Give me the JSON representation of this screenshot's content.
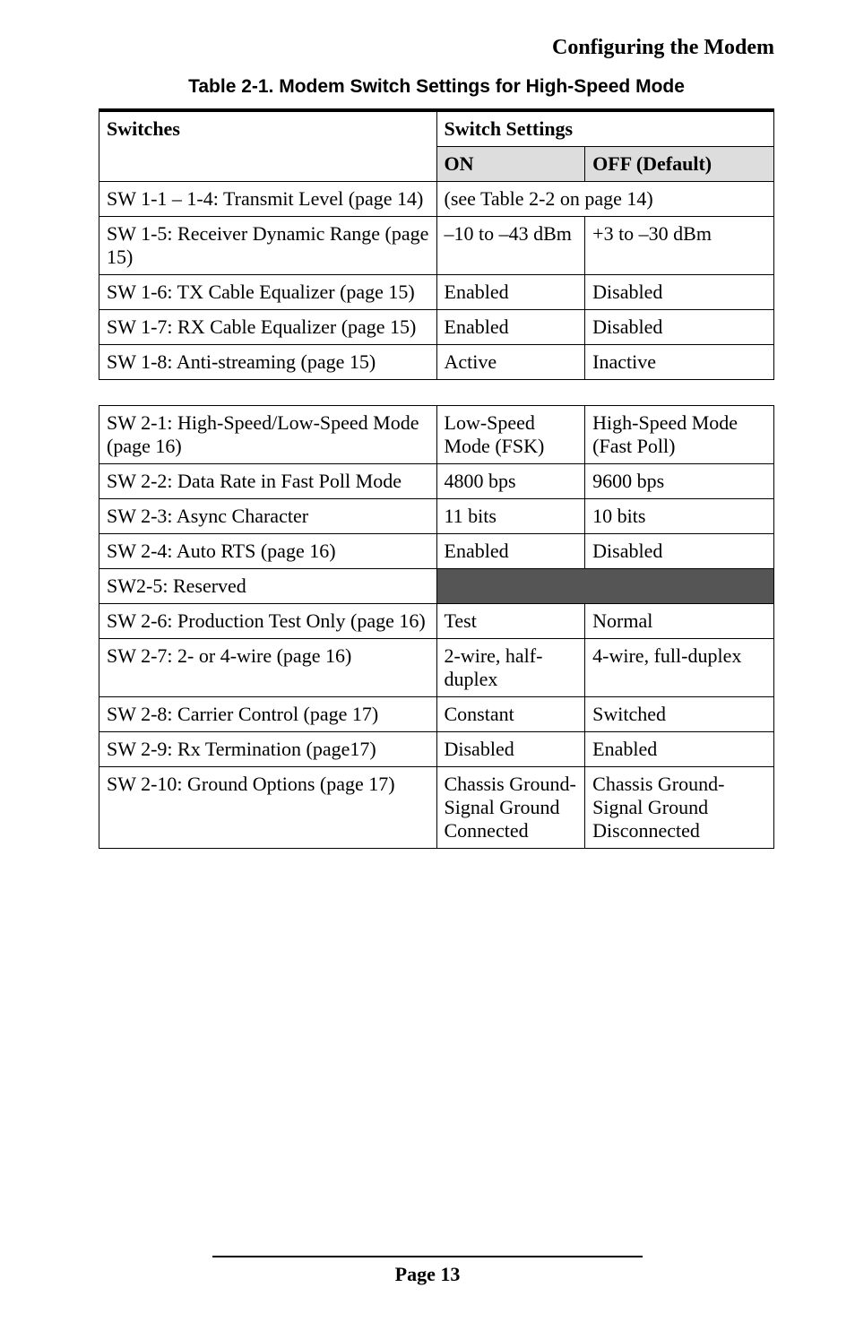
{
  "header": {
    "title": "Configuring the Modem"
  },
  "caption": "Table 2-1. Modem Switch Settings for High-Speed Mode",
  "headers": {
    "switches": "Switches",
    "settings": "Switch Settings",
    "on": "ON",
    "off": "OFF (Default)"
  },
  "t1": [
    {
      "label": "SW 1-1 – 1-4: Transmit Level (page 14)",
      "span": "(see Table 2-2 on page 14)"
    },
    {
      "label": "SW 1-5: Receiver Dynamic Range (page 15)",
      "on": "–10 to –43 dBm",
      "off": "+3 to –30 dBm"
    },
    {
      "label": "SW 1-6: TX Cable Equalizer (page 15)",
      "on": "Enabled",
      "off": "Disabled"
    },
    {
      "label": "SW 1-7: RX Cable Equalizer (page 15)",
      "on": "Enabled",
      "off": "Disabled"
    },
    {
      "label": "SW 1-8: Anti-streaming (page 15)",
      "on": "Active",
      "off": "Inactive"
    }
  ],
  "t2": [
    {
      "label": "SW 2-1: High-Speed/Low-Speed Mode (page 16)",
      "on": "Low-Speed Mode (FSK)",
      "off": "High-Speed Mode (Fast Poll)"
    },
    {
      "label": "SW 2-2: Data Rate in Fast Poll Mode",
      "on": "4800 bps",
      "off": "9600 bps"
    },
    {
      "label": "SW 2-3: Async Character",
      "on": "11 bits",
      "off": "10 bits"
    },
    {
      "label": "SW 2-4: Auto RTS (page 16)",
      "on": "Enabled",
      "off": "Disabled"
    },
    {
      "label": "SW2-5: Reserved",
      "reserved": true
    },
    {
      "label": "SW 2-6: Production Test Only (page 16)",
      "on": "Test",
      "off": "Normal"
    },
    {
      "label": "SW 2-7: 2- or 4-wire (page 16)",
      "on": "2-wire, half-duplex",
      "off": "4-wire, full-duplex"
    },
    {
      "label": "SW 2-8: Carrier Control (page 17)",
      "on": "Constant",
      "off": "Switched"
    },
    {
      "label": "SW 2-9: Rx Termination (page17)",
      "on": "Disabled",
      "off": "Enabled"
    },
    {
      "label": "SW 2-10: Ground Options (page 17)",
      "on": "Chassis Ground-Signal Ground Connected",
      "off": "Chassis Ground-Signal Ground Disconnected"
    }
  ],
  "footer": {
    "page_label": "Page 13"
  }
}
